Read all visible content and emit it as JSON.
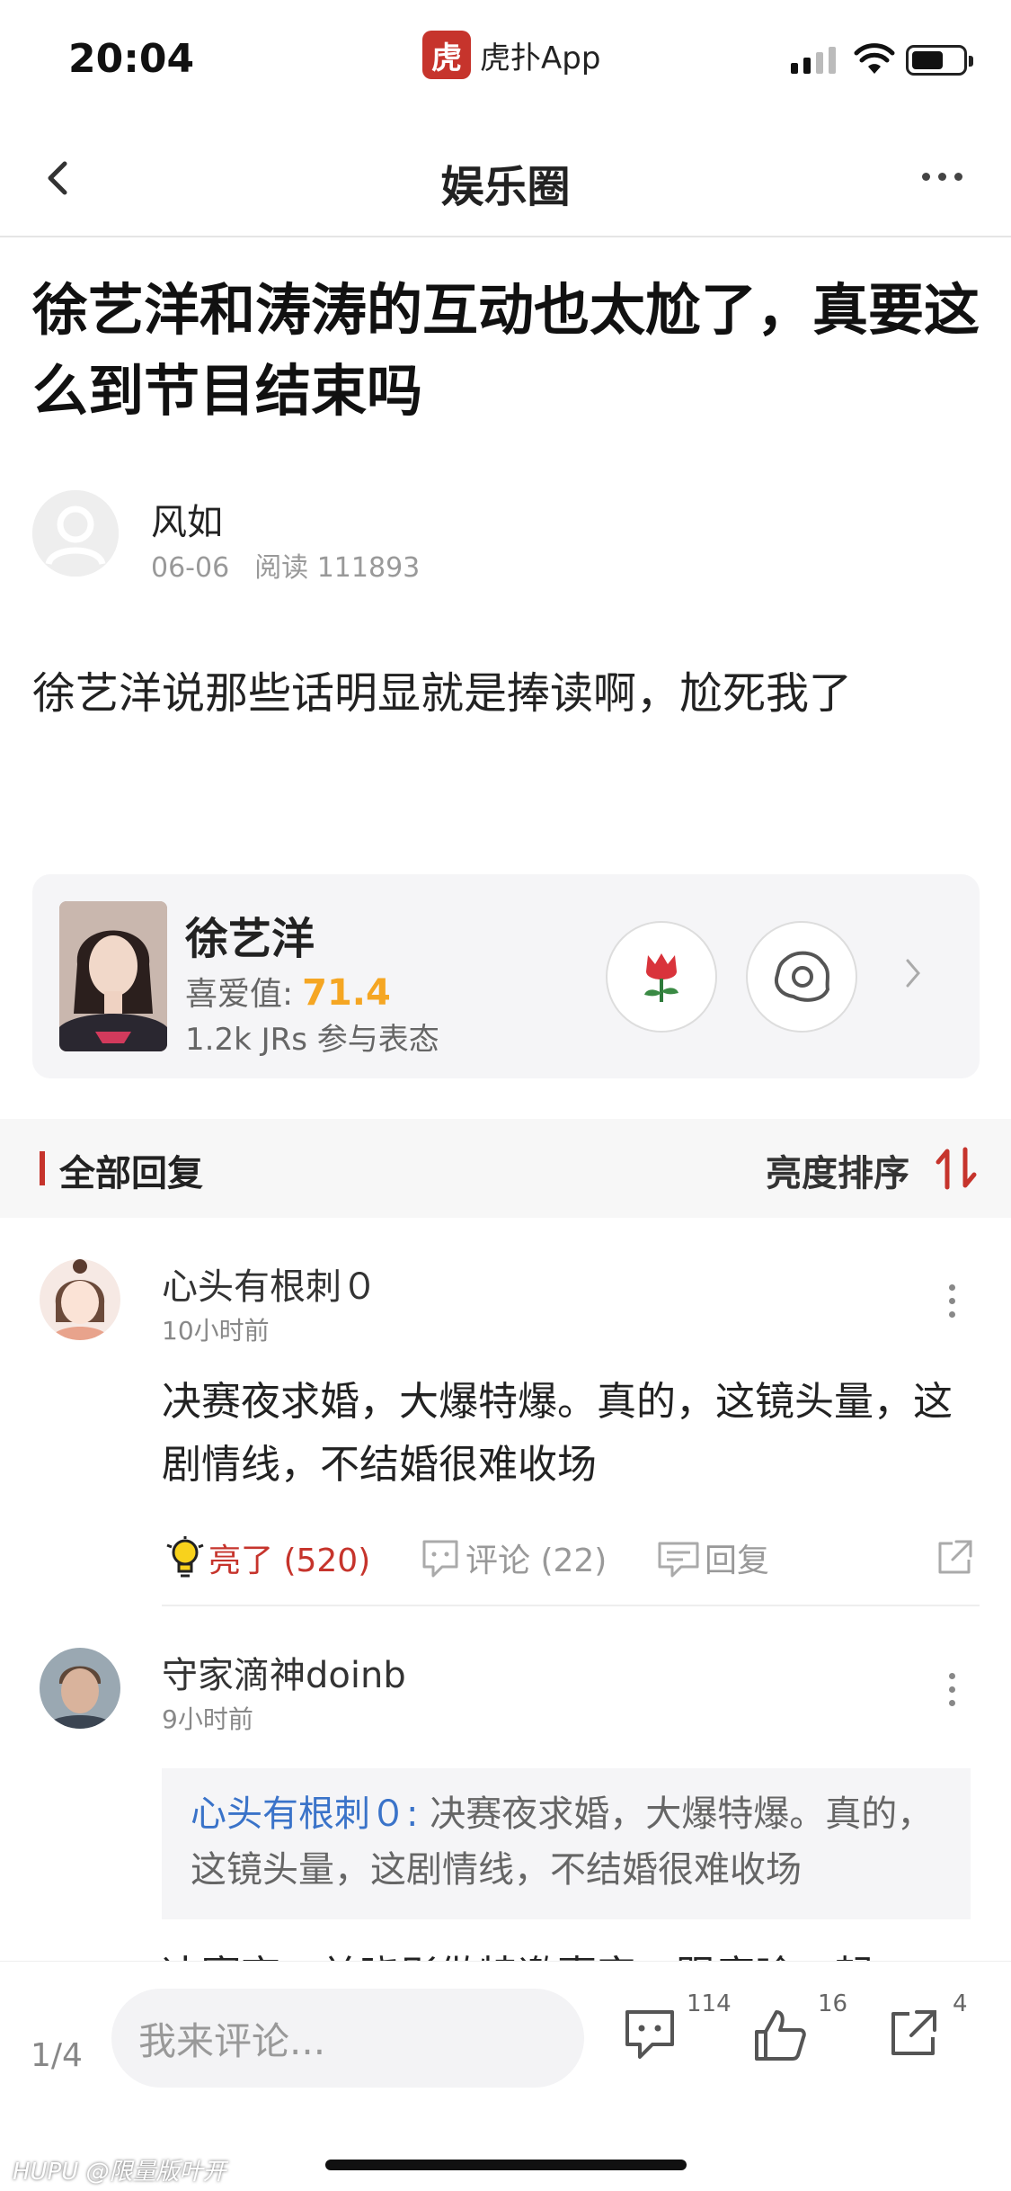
{
  "status_bar": {
    "time": "20:04",
    "app_logo_char": "虎",
    "app_name": "虎扑App"
  },
  "nav": {
    "title": "娱乐圈"
  },
  "post": {
    "title": "徐艺洋和涛涛的互动也太尬了，真要这么到节目结束吗",
    "author": "风如",
    "date": "06-06",
    "reads": "阅读 111893",
    "body": "徐艺洋说那些话明显就是捧读啊，尬死我了"
  },
  "star_card": {
    "name": "徐艺洋",
    "love_label": "喜爱值:",
    "love_value": "71.4",
    "jrs": "1.2k JRs 参与表态"
  },
  "section": {
    "title": "全部回复",
    "sort_label": "亮度排序"
  },
  "comments": [
    {
      "user": "心头有根刺０",
      "time": "10小时前",
      "text": "决赛夜求婚，大爆特爆。真的，这镜头量，这剧情线，不结婚很难收场",
      "light_label": "亮了 (520)",
      "comment_label": "评论 (22)",
      "reply_label": "回复"
    },
    {
      "user": "守家滴神doinb",
      "time": "9小时前",
      "quote_user": "心头有根刺０:",
      "quote_text": " 决赛夜求婚，大爆特爆。真的，这镜头量，这剧情线，不结婚很难收场",
      "text_cut": "决赛夜，关晓彤做特邀嘉宾，跟鹿晗一起"
    }
  ],
  "bottom_bar": {
    "pager": "1/4",
    "input_placeholder": "我来评论...",
    "comments_count": "114",
    "likes_count": "16",
    "shares_count": "4"
  },
  "watermark": "HUPU @限量版叶开",
  "colors": {
    "accent": "#c6342c",
    "love": "#f5a623",
    "link": "#3a73c9"
  }
}
